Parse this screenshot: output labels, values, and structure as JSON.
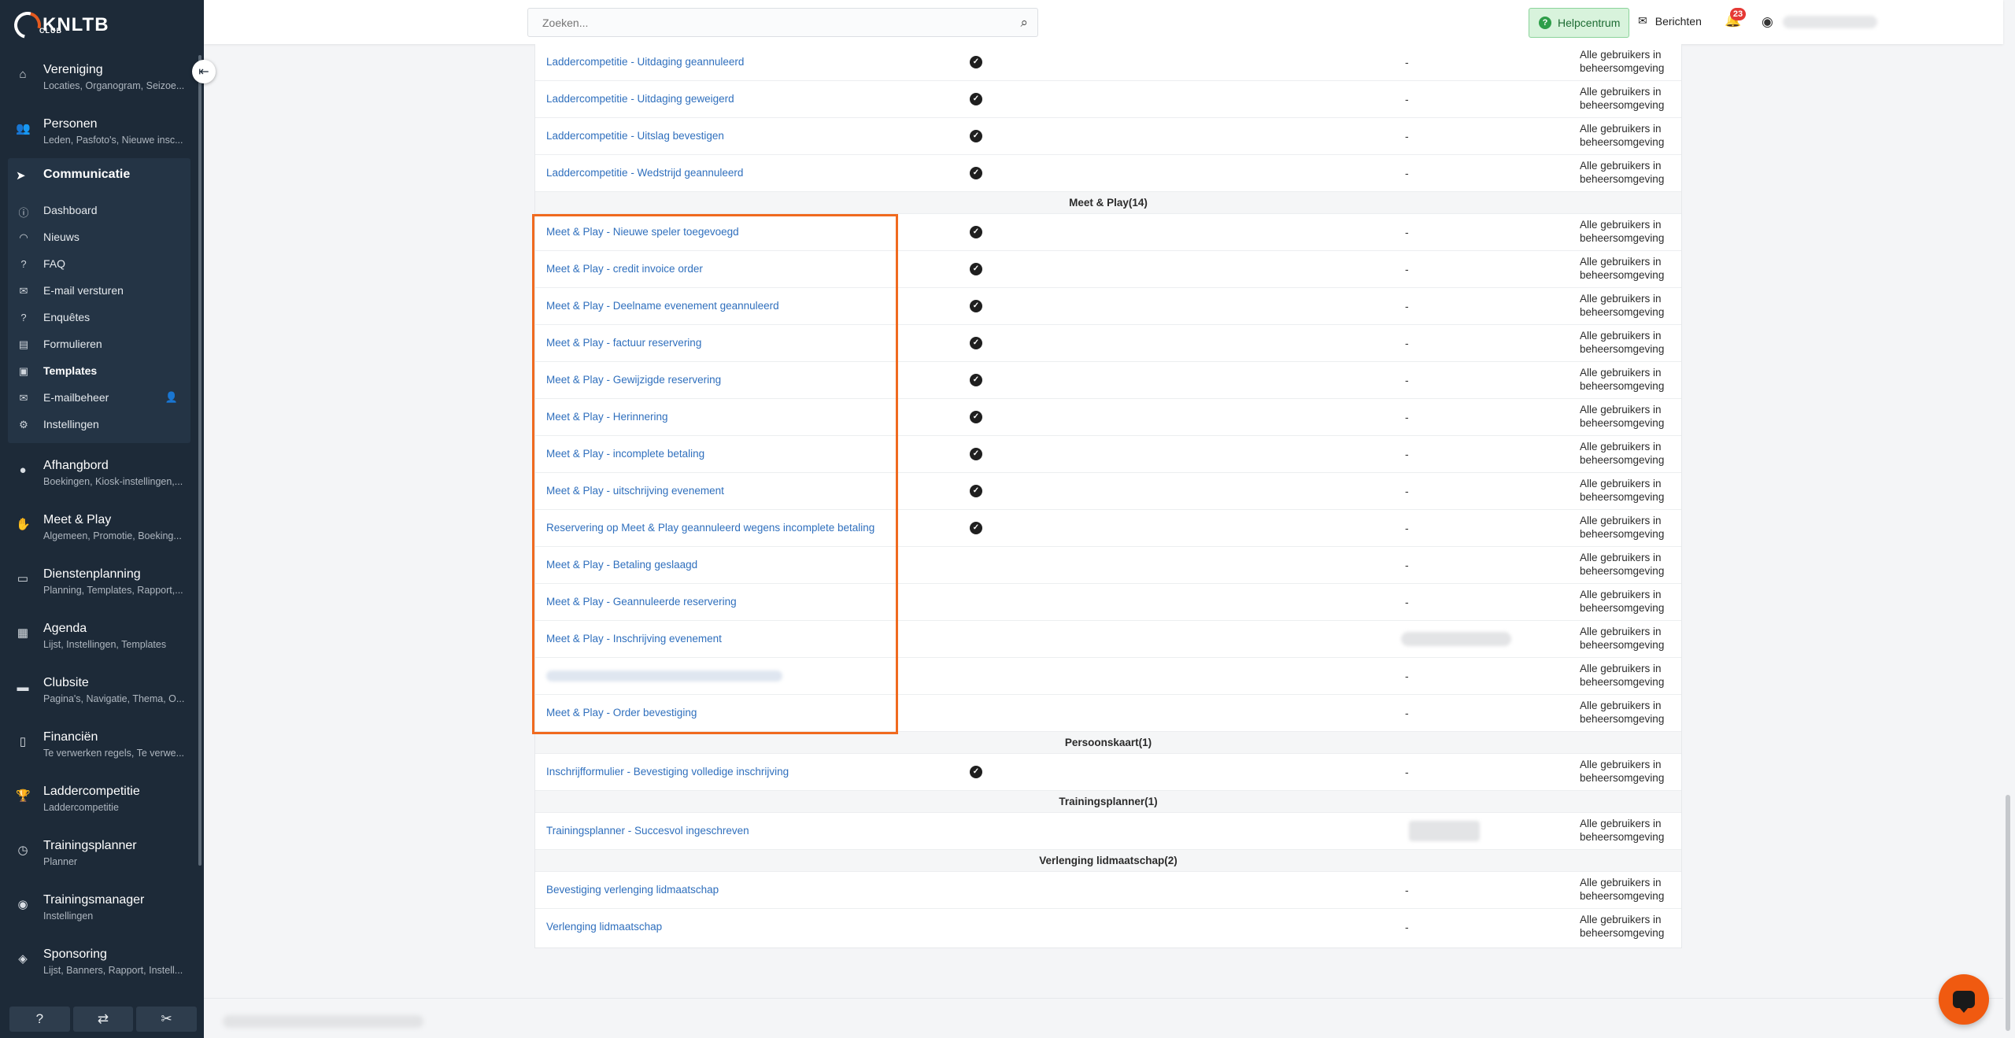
{
  "brand": {
    "logo_text": "KNLTB",
    "logo_sub": "CLUB"
  },
  "sidebar": {
    "groups_top": [
      {
        "title": "Vereniging",
        "sub": "Locaties, Organogram, Seizoe...",
        "icon": "home-icon"
      },
      {
        "title": "Personen",
        "sub": "Leden, Pasfoto's, Nieuwe insc...",
        "icon": "users-icon"
      }
    ],
    "communicatie": {
      "title": "Communicatie",
      "items": [
        {
          "label": "Dashboard",
          "icon": "info-icon"
        },
        {
          "label": "Nieuws",
          "icon": "rss-icon"
        },
        {
          "label": "FAQ",
          "icon": "question-icon"
        },
        {
          "label": "E-mail versturen",
          "icon": "mail-send-icon"
        },
        {
          "label": "Enquêtes",
          "icon": "question-circle-icon"
        },
        {
          "label": "Formulieren",
          "icon": "form-icon"
        },
        {
          "label": "Templates",
          "icon": "template-icon"
        },
        {
          "label": "E-mailbeheer",
          "icon": "envelope-icon"
        },
        {
          "label": "Instellingen",
          "icon": "settings-icon"
        }
      ]
    },
    "groups_bottom": [
      {
        "title": "Afhangbord",
        "sub": "Boekingen, Kiosk-instellingen,...",
        "icon": "tennis-ball-icon"
      },
      {
        "title": "Meet & Play",
        "sub": "Algemeen, Promotie, Boeking...",
        "icon": "handshake-icon"
      },
      {
        "title": "Dienstenplanning",
        "sub": "Planning, Templates, Rapport,...",
        "icon": "planning-icon"
      },
      {
        "title": "Agenda",
        "sub": "Lijst, Instellingen, Templates",
        "icon": "calendar-icon"
      },
      {
        "title": "Clubsite",
        "sub": "Pagina's, Navigatie, Thema, O...",
        "icon": "browser-icon"
      },
      {
        "title": "Financiën",
        "sub": "Te verwerken regels, Te verwe...",
        "icon": "invoice-icon"
      },
      {
        "title": "Laddercompetitie",
        "sub": "Laddercompetitie",
        "icon": "trophy-icon"
      },
      {
        "title": "Trainingsplanner",
        "sub": "Planner",
        "icon": "clock-icon"
      },
      {
        "title": "Trainingsmanager",
        "sub": "Instellingen",
        "icon": "user-circle-icon"
      },
      {
        "title": "Sponsoring",
        "sub": "Lijst, Banners, Rapport, Instell...",
        "icon": "sponsor-icon"
      }
    ]
  },
  "topbar": {
    "search_placeholder": "Zoeken...",
    "help_label": "Helpcentrum",
    "messages_label": "Berichten",
    "notification_count": "23"
  },
  "table": {
    "default_col4": "Alle gebruikers in beheersomgeving",
    "rows_top": [
      {
        "name": "Laddercompetitie - Uitdaging geannuleerd",
        "checked": true,
        "col3": "-"
      },
      {
        "name": "Laddercompetitie - Uitdaging geweigerd",
        "checked": true,
        "col3": "-"
      },
      {
        "name": "Laddercompetitie - Uitslag bevestigen",
        "checked": true,
        "col3": "-"
      },
      {
        "name": "Laddercompetitie - Wedstrijd geannuleerd",
        "checked": true,
        "col3": "-"
      }
    ],
    "group_meet": "Meet & Play(14)",
    "rows_meet": [
      {
        "name": "Meet & Play - Nieuwe speler toegevoegd",
        "checked": true,
        "col3": "-"
      },
      {
        "name": "Meet & Play - credit invoice order",
        "checked": true,
        "col3": "-"
      },
      {
        "name": "Meet & Play - Deelname evenement geannuleerd",
        "checked": true,
        "col3": "-"
      },
      {
        "name": "Meet & Play - factuur reservering",
        "checked": true,
        "col3": "-"
      },
      {
        "name": "Meet & Play - Gewijzigde reservering",
        "checked": true,
        "col3": "-"
      },
      {
        "name": "Meet & Play - Herinnering",
        "checked": true,
        "col3": "-"
      },
      {
        "name": "Meet & Play - incomplete betaling",
        "checked": true,
        "col3": "-"
      },
      {
        "name": "Meet & Play - uitschrijving evenement",
        "checked": true,
        "col3": "-"
      },
      {
        "name": "Reservering op Meet & Play geannuleerd wegens incomplete betaling",
        "checked": true,
        "col3": "-"
      },
      {
        "name": "Meet & Play - Betaling geslaagd",
        "checked": false,
        "col3": "-"
      },
      {
        "name": "Meet & Play - Geannuleerde reservering",
        "checked": false,
        "col3": "-"
      },
      {
        "name": "Meet & Play - Inschrijving evenement",
        "checked": false,
        "col3": ""
      },
      {
        "name": "",
        "checked": false,
        "col3": "-"
      },
      {
        "name": "Meet & Play - Order bevestiging",
        "checked": false,
        "col3": "-"
      }
    ],
    "group_persoon": "Persoonskaart(1)",
    "rows_persoon": [
      {
        "name": "Inschrijfformulier - Bevestiging volledige inschrijving",
        "checked": true,
        "col3": "-"
      }
    ],
    "group_training": "Trainingsplanner(1)",
    "rows_training": [
      {
        "name": "Trainingsplanner - Succesvol ingeschreven",
        "checked": false,
        "col3": ""
      }
    ],
    "group_verlenging": "Verlenging lidmaatschap(2)",
    "rows_verlenging": [
      {
        "name": "Bevestiging verlenging lidmaatschap",
        "checked": false,
        "col3": "-"
      },
      {
        "name": "Verlenging lidmaatschap",
        "checked": false,
        "col3": "-"
      }
    ]
  },
  "colors": {
    "accent": "#f06a1f",
    "link": "#2f6fbd",
    "sidebar_bg": "#1d2a38",
    "help_bg": "#d8f3dc"
  }
}
